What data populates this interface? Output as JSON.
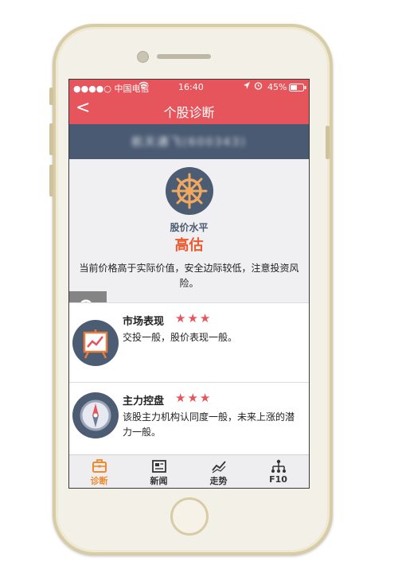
{
  "statusbar": {
    "carrier": "●●●●○ 中国电信",
    "time": "16:40",
    "battery": "45%"
  },
  "navbar": {
    "back": "<",
    "title": "个股诊断"
  },
  "stock": {
    "name": "航天通飞(600343)"
  },
  "level": {
    "icon": "ship-wheel-icon",
    "label": "股价水平",
    "value": "高估",
    "description": "当前价格高于实际价值，安全边际较低，注意投资风险。"
  },
  "cards": [
    {
      "icon": "chart-easel-icon",
      "title": "市场表现",
      "stars": "★★★",
      "rating": 3,
      "description": "交投一般，股价表现一般。"
    },
    {
      "icon": "compass-icon",
      "title": "主力控盘",
      "stars": "★★★",
      "rating": 3,
      "description": "该股主力机构认同度一般，未来上涨的潜力一般。"
    }
  ],
  "tabs": [
    {
      "label": "诊断",
      "icon": "briefcase-icon",
      "active": true
    },
    {
      "label": "新闻",
      "icon": "newspaper-icon",
      "active": false
    },
    {
      "label": "走势",
      "icon": "trend-icon",
      "active": false
    },
    {
      "label": "F10",
      "icon": "hierarchy-icon",
      "active": false
    }
  ],
  "colors": {
    "accent": "#e5555b",
    "navy": "#4a5a72",
    "highlight": "#ee5b30",
    "tab_active": "#ee8a2e"
  }
}
